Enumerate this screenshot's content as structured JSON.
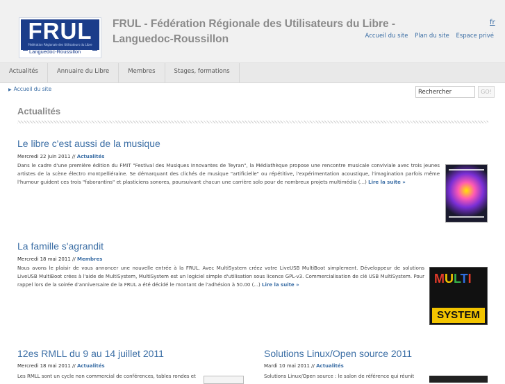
{
  "header": {
    "logo": {
      "brand": "FRUL",
      "subtitle": "Fédération Régionale des Utilisateurs du Libre",
      "region": "Languedoc-Roussillon"
    },
    "site_title": "FRUL - Fédération Régionale des Utilisateurs du Libre - Languedoc-Roussillon",
    "lang": "fr",
    "top_links": [
      "Accueil du site",
      "Plan du site",
      "Espace privé"
    ]
  },
  "nav": {
    "tabs": [
      "Actualités",
      "Annuaire du Libre",
      "Membres",
      "Stages, formations"
    ]
  },
  "breadcrumb": {
    "home": "Accueil du site"
  },
  "search": {
    "value": "Rechercher",
    "button": "GO!"
  },
  "section_title": "Actualités",
  "articles": [
    {
      "title": "Le libre c'est aussi de la musique",
      "date": "Mercredi 22 juin 2011",
      "sep": "//",
      "category": "Actualités",
      "body": "Dans le cadre d'une première édition du FMIT \"Festival des Musiques Innovantes de Teyran\", la Médiathèque propose une rencontre musicale conviviale avec trois jeunes artistes de la scène électro montpelliéraine. Se démarquant des clichés de musique \"artificielle\" ou répétitive, l'expérimentation acoustique, l'imagination parfois même l'humour guident ces trois \"faborantins\" et plasticiens sonores, poursuivant chacun une carrière solo pour de nombreux projets multimédia (...)",
      "more": "Lire la suite »"
    },
    {
      "title": "La famille s'agrandit",
      "date": "Mercredi 18 mai 2011",
      "sep": "//",
      "category": "Membres",
      "body": "Nous avons le plaisir de vous annoncer une nouvelle entrée à la FRUL. Avec MultiSystem créez votre LiveUSB MultiBoot simplement. Développeur de solutions LiveUSB MultiBoot crées à l'aide de MultiSystem, MultiSystem est un logiciel simple d'utilisation sous licence GPL-v3. Commercialisation de clé USB MultiSystem. Pour rappel lors de la soirée d'anniversaire de la FRUL a été décidé le montant de l'adhésion à 50.00 (...)",
      "more": "Lire la suite »",
      "thumb": {
        "word": [
          "M",
          "U",
          "L",
          "T",
          "I"
        ],
        "label": "SYSTEM"
      }
    },
    {
      "title": "12es RMLL du 9 au 14 juillet 2011",
      "date": "Mercredi 18 mai 2011",
      "sep": "//",
      "category": "Actualités",
      "body": "Les RMLL sont un cycle non commercial de conférences, tables rondes et"
    },
    {
      "title": "Solutions Linux/Open source 2011",
      "date": "Mardi 10 mai 2011",
      "sep": "//",
      "category": "Actualités",
      "body": "Solutions Linux/Open source : le salon de référence qui réunit"
    }
  ],
  "colors": {
    "link": "#3b6ea5",
    "header_bg": "#f1f1f1",
    "nav_bg": "#e9e9e9",
    "logo_blue": "#1b3d8a"
  }
}
